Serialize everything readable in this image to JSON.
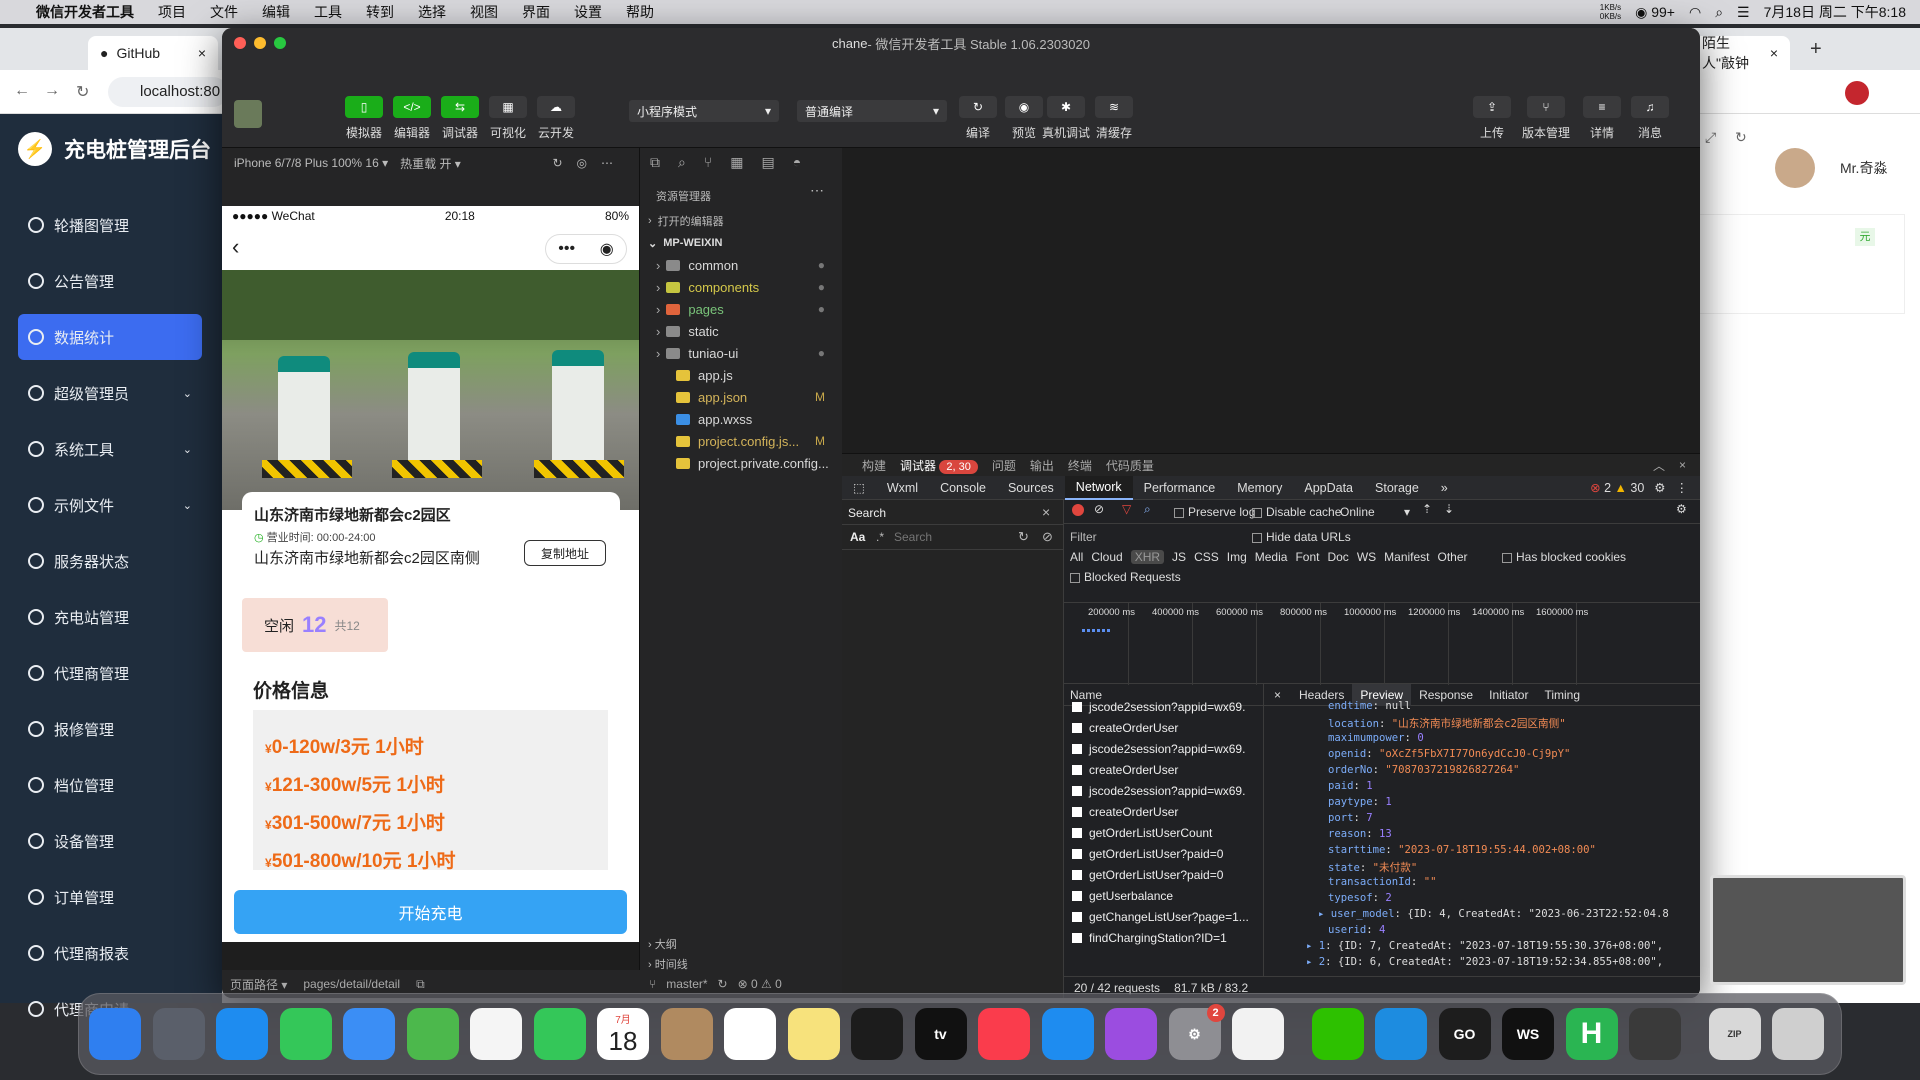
{
  "menubar": {
    "apple": "",
    "app": "微信开发者工具",
    "items": [
      "项目",
      "文件",
      "编辑",
      "工具",
      "转到",
      "选择",
      "视图",
      "界面",
      "设置",
      "帮助"
    ],
    "netspeed_up": "1KB/s",
    "netspeed_down": "0KB/s",
    "wechat_count": "99+",
    "datetime": "7月18日 周二 下午8:18"
  },
  "browser": {
    "tab1": "GitHub",
    "tab2": "陌生人\"敲钟",
    "address": "localhost:80",
    "user": "Mr.奇淼",
    "yuan_badge": "元"
  },
  "admin": {
    "title": "充电桩管理后台",
    "nav": [
      {
        "label": "轮播图管理",
        "expand": ""
      },
      {
        "label": "公告管理",
        "expand": ""
      },
      {
        "label": "数据统计",
        "expand": ""
      },
      {
        "label": "超级管理员",
        "expand": "⌄"
      },
      {
        "label": "系统工具",
        "expand": "⌄"
      },
      {
        "label": "示例文件",
        "expand": "⌄"
      },
      {
        "label": "服务器状态",
        "expand": ""
      },
      {
        "label": "充电站管理",
        "expand": ""
      },
      {
        "label": "代理商管理",
        "expand": ""
      },
      {
        "label": "报修管理",
        "expand": ""
      },
      {
        "label": "档位管理",
        "expand": ""
      },
      {
        "label": "设备管理",
        "expand": ""
      },
      {
        "label": "订单管理",
        "expand": ""
      },
      {
        "label": "代理商报表",
        "expand": ""
      },
      {
        "label": "代理商申请",
        "expand": ""
      }
    ]
  },
  "devtools": {
    "title": "chane",
    "subtitle": " - 微信开发者工具 Stable 1.06.2303020",
    "toolbar_left": [
      "模拟器",
      "编辑器",
      "调试器",
      "可视化",
      "云开发"
    ],
    "mode": "小程序模式",
    "compile_mode": "普通编译",
    "toolbar_mid": [
      "编译",
      "预览",
      "真机调试",
      "清缓存"
    ],
    "toolbar_right": [
      "上传",
      "版本管理",
      "详情",
      "消息"
    ],
    "device": "iPhone 6/7/8 Plus 100% 16 ▾",
    "hotreload": "热重载 开 ▾",
    "page_path_label": "页面路径 ▾",
    "page_path": "pages/detail/detail"
  },
  "phone": {
    "carrier": "●●●●● WeChat",
    "time": "20:18",
    "battery": "80%",
    "station_name": "山东济南市绿地新都会c2园区",
    "hours_label": "营业时间:",
    "hours": "00:00-24:00",
    "address": "山东济南市绿地新都会c2园区南侧",
    "copy_btn": "复制地址",
    "idle_label": "空闲",
    "idle_count": "12",
    "idle_total": "共12",
    "price_title": "价格信息",
    "prices": [
      "0-120w/3元 1小时",
      "121-300w/5元 1小时",
      "301-500w/7元 1小时",
      "501-800w/10元 1小时"
    ],
    "yen": "¥",
    "start_btn": "开始充电"
  },
  "explorer": {
    "title": "资源管理器",
    "open_editors": "打开的编辑器",
    "root": "MP-WEIXIN",
    "files": [
      {
        "name": "common",
        "status": "●",
        "color": "#8a8a8a"
      },
      {
        "name": "components",
        "status": "●",
        "color": "#c5c540"
      },
      {
        "name": "pages",
        "status": "●",
        "color": "#e0643c"
      },
      {
        "name": "static",
        "status": "",
        "color": "#8a8a8a"
      },
      {
        "name": "tuniao-ui",
        "status": "●",
        "color": "#8a8a8a"
      },
      {
        "name": "app.js",
        "status": "",
        "color": "#e5c33b"
      },
      {
        "name": "app.json",
        "status": "M",
        "color": "#e5c33b"
      },
      {
        "name": "app.wxss",
        "status": "",
        "color": "#3b8fe5"
      },
      {
        "name": "project.config.js...",
        "status": "M",
        "color": "#e5c33b"
      },
      {
        "name": "project.private.config...",
        "status": "",
        "color": "#e5c33b"
      }
    ],
    "outline": "大纲",
    "timeline": "时间线",
    "branch": "master*",
    "errors": "⊗ 0 ⚠ 0"
  },
  "debugger": {
    "tabs": [
      "构建",
      "调试器",
      "问题",
      "输出",
      "终端",
      "代码质量"
    ],
    "badge": "2, 30",
    "devtabs": [
      "Wxml",
      "Console",
      "Sources",
      "Network",
      "Performance",
      "Memory",
      "AppData",
      "Storage",
      "»"
    ],
    "err_count": "2",
    "warn_count": "30",
    "search_label": "Search",
    "search_placeholder": "Search",
    "preserve_log": "Preserve log",
    "disable_cache": "Disable cache",
    "throttle": "Online",
    "filter_label": "Filter",
    "hide_data_urls": "Hide data URLs",
    "type_filters": [
      "All",
      "Cloud",
      "XHR",
      "JS",
      "CSS",
      "Img",
      "Media",
      "Font",
      "Doc",
      "WS",
      "Manifest",
      "Other"
    ],
    "blocked_cookies": "Has blocked cookies",
    "blocked_requests": "Blocked Requests",
    "ticks": [
      "200000 ms",
      "400000 ms",
      "600000 ms",
      "800000 ms",
      "1000000 ms",
      "1200000 ms",
      "1400000 ms",
      "1600000 ms"
    ],
    "name_header": "Name",
    "detail_tabs": [
      "Headers",
      "Preview",
      "Response",
      "Initiator",
      "Timing"
    ],
    "requests": [
      "jscode2session?appid=wx69.",
      "createOrderUser",
      "jscode2session?appid=wx69.",
      "createOrderUser",
      "jscode2session?appid=wx69.",
      "createOrderUser",
      "getOrderListUserCount",
      "getOrderListUser?paid=0",
      "getOrderListUser?paid=0",
      "getUserbalance",
      "getChangeListUser?page=1...",
      "findChargingStation?ID=1"
    ],
    "preview": [
      {
        "k": "endtime",
        "v": "null",
        "t": "w"
      },
      {
        "k": "location",
        "v": "\"山东济南市绿地新都会c2园区南侧\"",
        "t": "s"
      },
      {
        "k": "maximumpower",
        "v": "0",
        "t": "n"
      },
      {
        "k": "openid",
        "v": "\"oXcZf5FbX7I77On6ydCcJ0-Cj9pY\"",
        "t": "s"
      },
      {
        "k": "orderNo",
        "v": "\"7087037219826827264\"",
        "t": "s"
      },
      {
        "k": "paid",
        "v": "1",
        "t": "n"
      },
      {
        "k": "paytype",
        "v": "1",
        "t": "n"
      },
      {
        "k": "port",
        "v": "7",
        "t": "n"
      },
      {
        "k": "reason",
        "v": "13",
        "t": "n"
      },
      {
        "k": "starttime",
        "v": "\"2023-07-18T19:55:44.002+08:00\"",
        "t": "s"
      },
      {
        "k": "state",
        "v": "\"未付款\"",
        "t": "s"
      },
      {
        "k": "transactionId",
        "v": "\"\"",
        "t": "s"
      },
      {
        "k": "typesof",
        "v": "2",
        "t": "n"
      },
      {
        "k": "▸ user_model",
        "v": "{ID: 4, CreatedAt: \"2023-06-23T22:52:04.8",
        "t": "w"
      },
      {
        "k": "userid",
        "v": "4",
        "t": "n"
      },
      {
        "k": "▸ 1",
        "v": "{ID: 7, CreatedAt: \"2023-07-18T19:55:30.376+08:00\",",
        "t": "w"
      },
      {
        "k": "▸ 2",
        "v": "{ID: 6, CreatedAt: \"2023-07-18T19:52:34.855+08:00\",",
        "t": "w"
      }
    ],
    "status": [
      "20 / 42 requests",
      "81.7 kB / 83.2"
    ]
  },
  "dock": {
    "calendar_month": "7月",
    "calendar_day": "18",
    "settings_badge": "2",
    "apps": [
      "Finder",
      "Launchpad",
      "Safari",
      "Messages",
      "Mail",
      "Maps",
      "Photos",
      "FaceTime",
      "Calendar",
      "Contacts",
      "Reminders",
      "Notes",
      "Terminal",
      "TV",
      "Music",
      "App Store",
      "Podcasts",
      "Settings",
      "Chrome",
      "WeChat",
      "Docker",
      "GoLand",
      "WebStorm",
      "HBuilder",
      "DevTools",
      "Archive",
      "Trash"
    ],
    "labels": {
      "tv": "tv",
      "go": "GO",
      "ws": "WS",
      "h": "H",
      "zip": "ZIP"
    }
  },
  "colors": {
    "accent": "#3c6cf0",
    "sidebar": "#1f2d3d",
    "price": "#ee6a17",
    "start": "#35a3f4",
    "green": "#1aad19"
  }
}
